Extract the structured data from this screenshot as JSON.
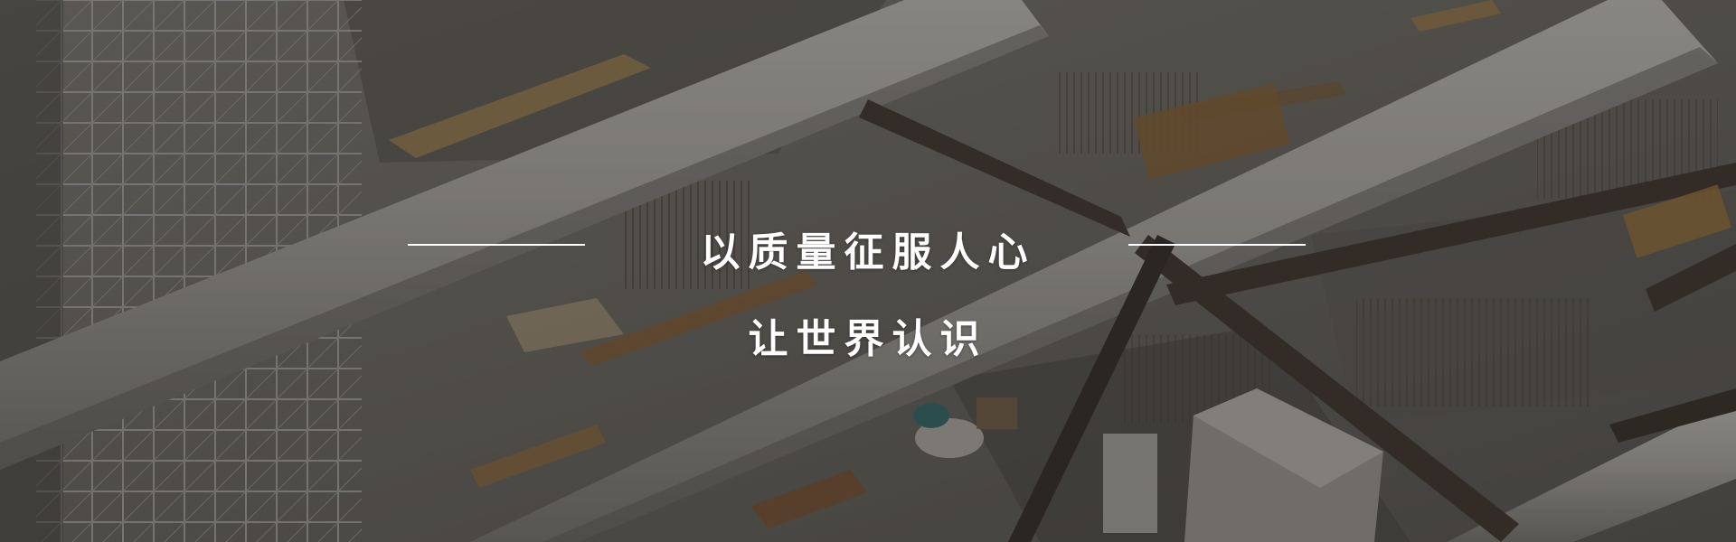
{
  "hero": {
    "headline_line1": "以质量征服人心",
    "headline_line2": "让世界认识",
    "background_image": "construction-site-aerial",
    "overlay_color": "#121212"
  }
}
